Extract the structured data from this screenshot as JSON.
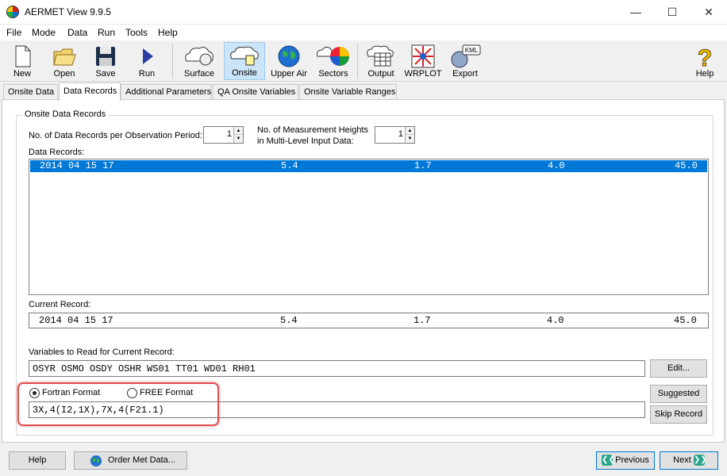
{
  "window": {
    "title": "AERMET View 9.9.5"
  },
  "menu": [
    "File",
    "Mode",
    "Data",
    "Run",
    "Tools",
    "Help"
  ],
  "toolbar": {
    "new": "New",
    "open": "Open",
    "save": "Save",
    "run": "Run",
    "surface": "Surface",
    "onsite": "Onsite",
    "upper_air": "Upper Air",
    "sectors": "Sectors",
    "output": "Output",
    "wrplot": "WRPLOT",
    "export": "Export",
    "help": "Help",
    "kml": "KML"
  },
  "tabs": [
    "Onsite Data",
    "Data Records",
    "Additional Parameters",
    "QA Onsite Variables",
    "Onsite Variable Ranges"
  ],
  "group": {
    "title": "Onsite Data Records",
    "records_label": "No. of Data Records per Observation Period:",
    "records_value": "1",
    "heights_label_1": "No. of Measurement Heights",
    "heights_label_2": "in Multi-Level Input Data:",
    "heights_value": "1",
    "data_records_label": "Data Records:",
    "data_records": [
      {
        "date": "2014 04 15 17",
        "c1": "5.4",
        "c2": "1.7",
        "c3": "4.0",
        "c4": "45.0"
      }
    ],
    "current_record_label": "Current Record:",
    "current_record": {
      "date": "2014 04 15 17",
      "c1": "5.4",
      "c2": "1.7",
      "c3": "4.0",
      "c4": "45.0"
    },
    "variables_label": "Variables to Read for Current Record:",
    "variables_value": "OSYR OSMO OSDY OSHR WS01 TT01 WD01 RH01",
    "edit_button": "Edit...",
    "fortran_label": "Fortran Format",
    "free_label": "FREE Format",
    "format_value": "3X,4(I2,1X),7X,4(F21.1)",
    "suggested_button": "Suggested",
    "skip_button": "Skip Record"
  },
  "bottom": {
    "help_button": "Help",
    "order_button": "Order Met Data...",
    "previous_button": "Previous",
    "next_button": "Next"
  },
  "colors": {
    "selection": "#0078d7",
    "highlight_border": "#e05050",
    "active_tool": "#cce4f7"
  }
}
